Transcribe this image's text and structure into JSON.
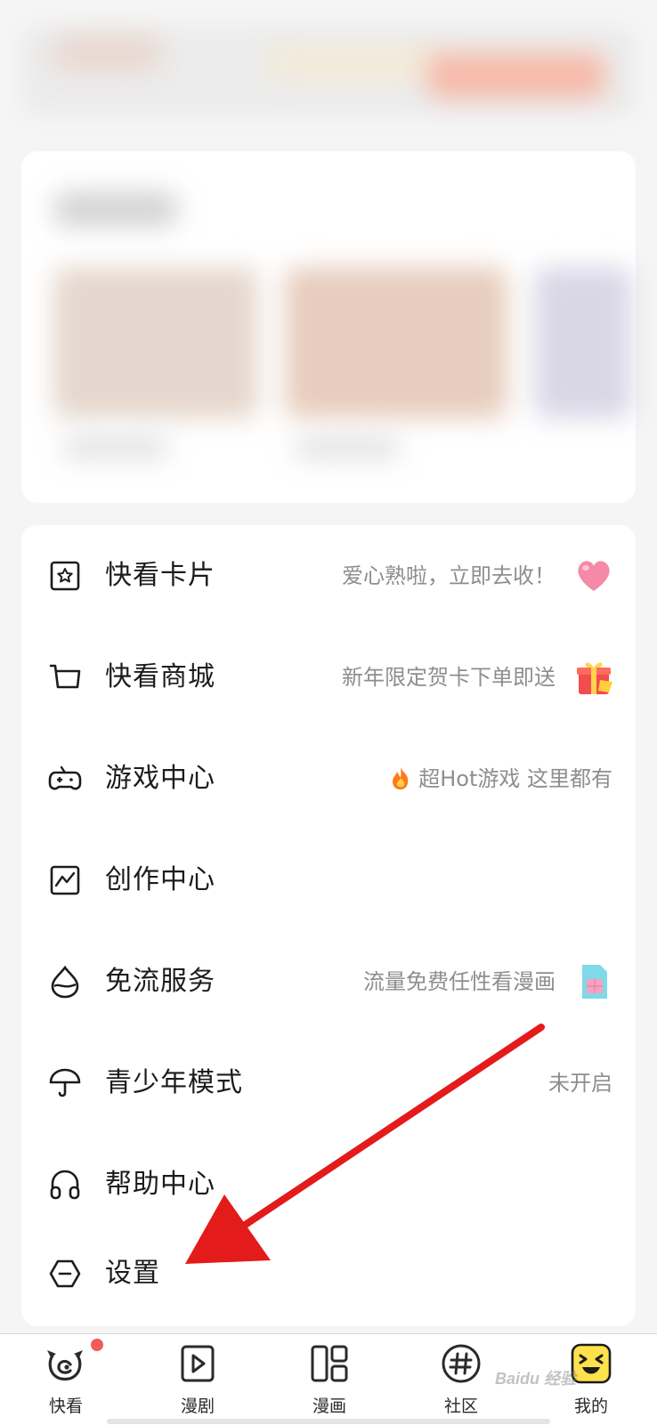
{
  "menu": {
    "items": [
      {
        "label": "快看卡片",
        "hint": "爱心熟啦，立即去收！",
        "icon": "card-star-icon",
        "badge": "heart-icon"
      },
      {
        "label": "快看商城",
        "hint": "新年限定贺卡下单即送",
        "icon": "cart-icon",
        "badge": "gift-icon"
      },
      {
        "label": "游戏中心",
        "hint": "超Hot游戏 这里都有",
        "icon": "gamepad-icon",
        "badge": "fire-icon"
      },
      {
        "label": "创作中心",
        "hint": "",
        "icon": "chart-icon",
        "badge": ""
      },
      {
        "label": "免流服务",
        "hint": "流量免费任性看漫画",
        "icon": "drop-icon",
        "badge": "sim-card-icon"
      },
      {
        "label": "青少年模式",
        "hint": "未开启",
        "icon": "umbrella-icon",
        "badge": ""
      },
      {
        "label": "帮助中心",
        "hint": "",
        "icon": "headphones-icon",
        "badge": ""
      },
      {
        "label": "设置",
        "hint": "",
        "icon": "settings-icon",
        "badge": ""
      }
    ]
  },
  "bottom_nav": {
    "items": [
      {
        "label": "快看",
        "icon": "kuaikan-icon"
      },
      {
        "label": "漫剧",
        "icon": "play-icon"
      },
      {
        "label": "漫画",
        "icon": "comic-grid-icon"
      },
      {
        "label": "社区",
        "icon": "hashtag-icon"
      },
      {
        "label": "我的",
        "icon": "smiley-icon"
      }
    ]
  },
  "watermark": "Baidu 经验",
  "colors": {
    "arrow": "#e31b1b",
    "nav_dot": "#f05b5b",
    "active_nav": "#ffe14d"
  }
}
